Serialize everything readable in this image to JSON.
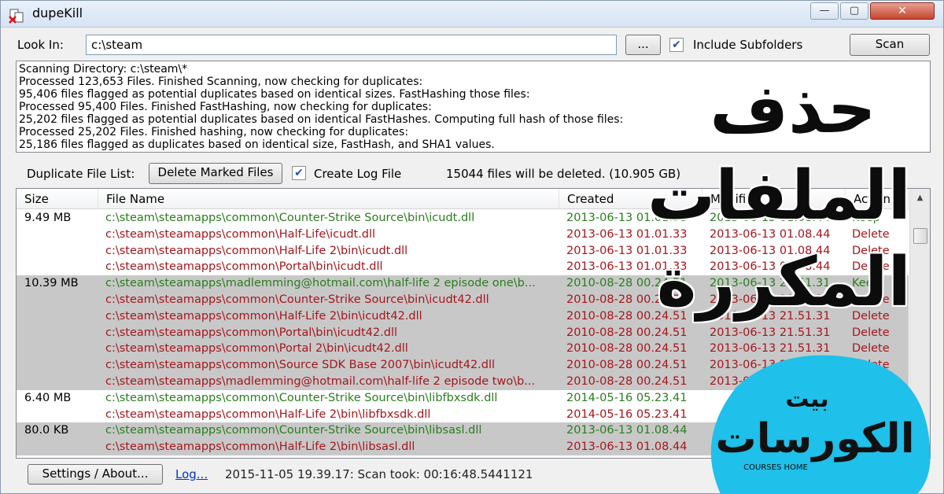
{
  "window": {
    "title": "dupeKill",
    "minimize": "—",
    "maximize": "▢",
    "close": "✕"
  },
  "toolbar": {
    "look_in_label": "Look In:",
    "look_in_value": "c:\\steam",
    "browse_label": "...",
    "include_subfolders_label": "Include Subfolders",
    "include_subfolders_checked": true,
    "scan_label": "Scan"
  },
  "log": [
    "Scanning Directory: c:\\steam\\*",
    "Processed 123,653 Files. Finished Scanning, now checking for duplicates:",
    "95,406 files flagged as potential duplicates based on identical sizes. FastHashing those files:",
    "Processed 95,400 Files. Finished FastHashing, now checking for duplicates:",
    "25,202 files flagged as potential duplicates based on identical FastHashes. Computing full hash of those files:",
    "Processed 25,202 Files. Finished hashing, now checking for duplicates:",
    "25,186 files flagged as duplicates based on identical size, FastHash, and SHA1 values."
  ],
  "duplicates": {
    "list_label": "Duplicate File List:",
    "delete_button": "Delete Marked Files",
    "create_log_label": "Create Log File",
    "create_log_checked": true,
    "summary": "15044 files will be deleted. (10.905 GB)"
  },
  "table": {
    "columns": [
      "Size",
      "File Name",
      "Created",
      "Modified",
      "Action"
    ],
    "rows": [
      {
        "size": "9.49 MB",
        "name": "c:\\steam\\steamapps\\common\\Counter-Strike Source\\bin\\icudt.dll",
        "created": "2013-06-13  01.01.33",
        "modified": "2013-06-13  01.08.44",
        "action": "Keep",
        "group": "a"
      },
      {
        "size": "",
        "name": "c:\\steam\\steamapps\\common\\Half-Life\\icudt.dll",
        "created": "2013-06-13  01.01.33",
        "modified": "2013-06-13  01.08.44",
        "action": "Delete",
        "group": "a"
      },
      {
        "size": "",
        "name": "c:\\steam\\steamapps\\common\\Half-Life 2\\bin\\icudt.dll",
        "created": "2013-06-13  01.01.33",
        "modified": "2013-06-13  01.08.44",
        "action": "Delete",
        "group": "a"
      },
      {
        "size": "",
        "name": "c:\\steam\\steamapps\\common\\Portal\\bin\\icudt.dll",
        "created": "2013-06-13  01.01.33",
        "modified": "2013-06-13  01.08.44",
        "action": "Delete",
        "group": "a"
      },
      {
        "size": "10.39 MB",
        "name": "c:\\steam\\steamapps\\madlemming@hotmail.com\\half-life 2 episode one\\b...",
        "created": "2010-08-28  00.24.51",
        "modified": "2013-06-13  21.51.31",
        "action": "Keep",
        "group": "b"
      },
      {
        "size": "",
        "name": "c:\\steam\\steamapps\\common\\Counter-Strike Source\\bin\\icudt42.dll",
        "created": "2010-08-28  00.24.51",
        "modified": "2013-06-13  21.51.31",
        "action": "Delete",
        "group": "b"
      },
      {
        "size": "",
        "name": "c:\\steam\\steamapps\\common\\Half-Life 2\\bin\\icudt42.dll",
        "created": "2010-08-28  00.24.51",
        "modified": "2013-06-13  21.51.31",
        "action": "Delete",
        "group": "b"
      },
      {
        "size": "",
        "name": "c:\\steam\\steamapps\\common\\Portal\\bin\\icudt42.dll",
        "created": "2010-08-28  00.24.51",
        "modified": "2013-06-13  21.51.31",
        "action": "Delete",
        "group": "b"
      },
      {
        "size": "",
        "name": "c:\\steam\\steamapps\\common\\Portal 2\\bin\\icudt42.dll",
        "created": "2010-08-28  00.24.51",
        "modified": "2013-06-13  21.51.31",
        "action": "Delete",
        "group": "b"
      },
      {
        "size": "",
        "name": "c:\\steam\\steamapps\\common\\Source SDK Base 2007\\bin\\icudt42.dll",
        "created": "2010-08-28  00.24.51",
        "modified": "2013-06-13  21.51.31",
        "action": "Delete",
        "group": "b"
      },
      {
        "size": "",
        "name": "c:\\steam\\steamapps\\madlemming@hotmail.com\\half-life 2 episode two\\b...",
        "created": "2010-08-28  00.24.51",
        "modified": "2013-06-13  21.51.31",
        "action": "Delete",
        "group": "b"
      },
      {
        "size": "6.40 MB",
        "name": "c:\\steam\\steamapps\\common\\Counter-Strike Source\\bin\\libfbxsdk.dll",
        "created": "2014-05-16  05.23.41",
        "modified": "",
        "action": "",
        "group": "a"
      },
      {
        "size": "",
        "name": "c:\\steam\\steamapps\\common\\Half-Life 2\\bin\\libfbxsdk.dll",
        "created": "2014-05-16  05.23.41",
        "modified": "",
        "action": "",
        "group": "a"
      },
      {
        "size": "80.0 KB",
        "name": "c:\\steam\\steamapps\\common\\Counter-Strike Source\\bin\\libsasl.dll",
        "created": "2013-06-13  01.08.44",
        "modified": "",
        "action": "",
        "group": "b"
      },
      {
        "size": "",
        "name": "c:\\steam\\steamapps\\common\\Half-Life 2\\bin\\libsasl.dll",
        "created": "2013-06-13  01.08.44",
        "modified": "",
        "action": "",
        "group": "b"
      }
    ]
  },
  "footer": {
    "settings_label": "Settings / About...",
    "log_link": "Log...",
    "status": "2015-11-05 19.39.17: Scan took: 00:16:48.5441121"
  },
  "overlay": {
    "title_lines": [
      "حذف",
      "الملفات",
      "المكررة"
    ],
    "logo_top": "بيت",
    "logo_main": "الكورسات",
    "logo_sub": "COURSES HOME"
  },
  "colors": {
    "keep": "#2a7d1c",
    "delete": "#a5161c",
    "group_shade": "#c8c8c8",
    "logo_circle": "#1fc0e9"
  }
}
